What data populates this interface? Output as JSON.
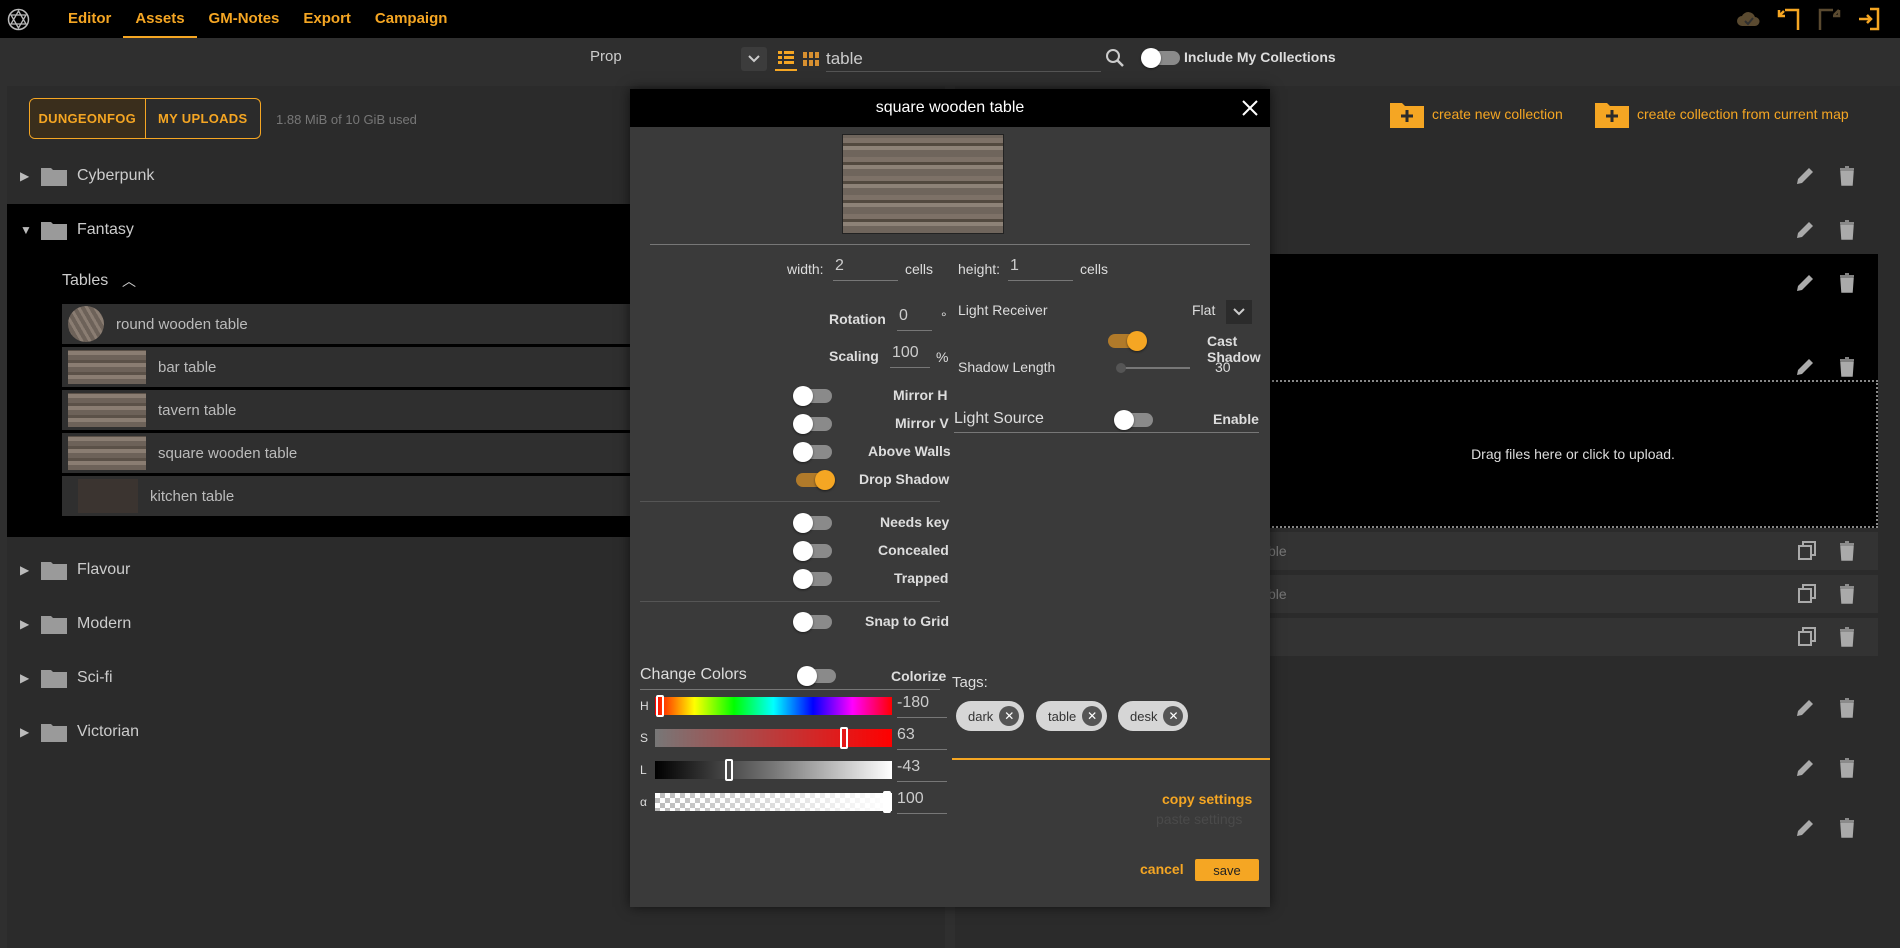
{
  "topbar": {
    "menu": [
      {
        "label": "Editor"
      },
      {
        "label": "Assets"
      },
      {
        "label": "GM-Notes"
      },
      {
        "label": "Export"
      },
      {
        "label": "Campaign"
      }
    ]
  },
  "search": {
    "type": "Prop",
    "query": "table",
    "include_label": "Include My Collections"
  },
  "left": {
    "tab_dungeonfog": "DUNGEONFOG",
    "tab_uploads": "MY UPLOADS",
    "usage": "1.88 MiB of 10 GiB used",
    "folders": {
      "cyberpunk": "Cyberpunk",
      "fantasy": "Fantasy",
      "flavour": "Flavour",
      "modern": "Modern",
      "scifi": "Sci-fi",
      "victorian": "Victorian"
    },
    "subfolder": "Tables",
    "assets": [
      {
        "name": "round wooden table"
      },
      {
        "name": "bar table"
      },
      {
        "name": "tavern table"
      },
      {
        "name": "square wooden table"
      },
      {
        "name": "kitchen table"
      }
    ]
  },
  "right": {
    "create_collection": "create new collection",
    "create_from_map": "create collection from current map",
    "dropzone": "Drag files here or click to upload.",
    "mini_rows": [
      "ble",
      "ble",
      ""
    ]
  },
  "modal": {
    "title": "square wooden table",
    "width_label": "width:",
    "width_value": "2",
    "width_unit": "cells",
    "height_label": "height:",
    "height_value": "1",
    "height_unit": "cells",
    "rotation_label": "Rotation",
    "rotation_value": "0",
    "rotation_unit": "°",
    "scaling_label": "Scaling",
    "scaling_value": "100",
    "scaling_unit": "%",
    "mirror_h": "Mirror H",
    "mirror_v": "Mirror V",
    "above_walls": "Above Walls",
    "drop_shadow": "Drop Shadow",
    "needs_key": "Needs key",
    "concealed": "Concealed",
    "trapped": "Trapped",
    "snap_to_grid": "Snap to Grid",
    "change_colors": "Change Colors",
    "colorize": "Colorize",
    "light_receiver": "Light Receiver",
    "light_receiver_value": "Flat",
    "cast_shadow": "Cast Shadow",
    "shadow_length_label": "Shadow Length",
    "shadow_length_value": "30",
    "light_source": "Light Source",
    "enable": "Enable",
    "tags_label": "Tags:",
    "tags": [
      "dark",
      "table",
      "desk"
    ],
    "hsl": {
      "h_label": "H",
      "h_value": "-180",
      "s_label": "S",
      "s_value": "63",
      "l_label": "L",
      "l_value": "-43",
      "a_label": "α",
      "a_value": "100"
    },
    "copy_settings": "copy settings",
    "paste_settings": "paste settings",
    "cancel": "cancel",
    "save": "save"
  },
  "colors": {
    "accent": "#f5a623",
    "bg": "#2f2f2f",
    "modal": "#3a3a3a"
  }
}
